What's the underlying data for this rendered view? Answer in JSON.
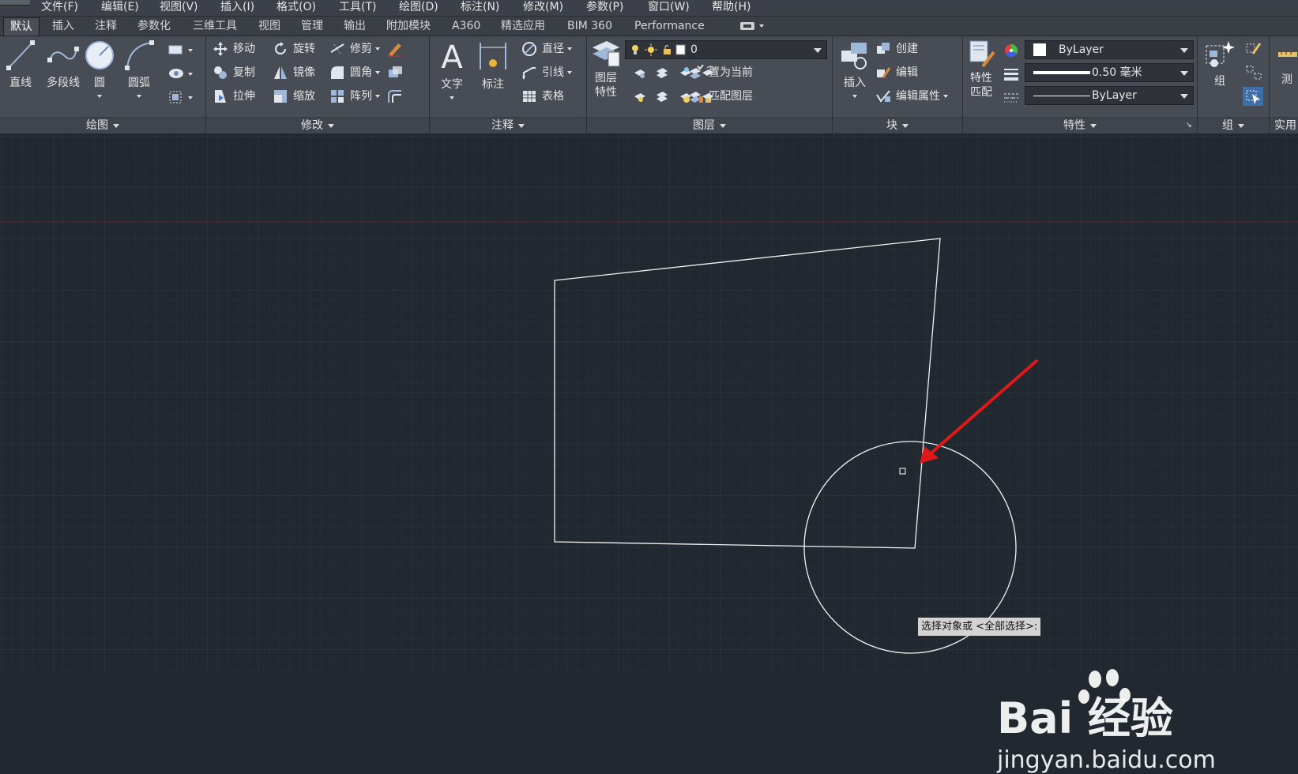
{
  "menubar": {
    "items": [
      "文件(F)",
      "编辑(E)",
      "视图(V)",
      "插入(I)",
      "格式(O)",
      "工具(T)",
      "绘图(D)",
      "标注(N)",
      "修改(M)",
      "参数(P)",
      "窗口(W)",
      "帮助(H)"
    ]
  },
  "tabs": [
    "默认",
    "插入",
    "注释",
    "参数化",
    "三维工具",
    "视图",
    "管理",
    "输出",
    "附加模块",
    "A360",
    "精选应用",
    "BIM 360",
    "Performance"
  ],
  "active_tab": "默认",
  "ribbon": {
    "draw": {
      "title": "绘图",
      "line": "直线",
      "polyline": "多段线",
      "circle": "圆",
      "arc": "圆弧"
    },
    "modify": {
      "title": "修改",
      "move": "移动",
      "rotate": "旋转",
      "trim": "修剪",
      "copy": "复制",
      "mirror": "镜像",
      "fillet": "圆角",
      "stretch": "拉伸",
      "scale": "缩放",
      "array": "阵列"
    },
    "annotation": {
      "title": "注释",
      "text": "文字",
      "dimension": "标注",
      "diameter": "直径",
      "leader": "引线",
      "table": "表格"
    },
    "layers": {
      "title": "图层",
      "properties_line1": "图层",
      "properties_line2": "特性",
      "current_layer": "0",
      "set_current": "置为当前",
      "match_layer": "匹配图层"
    },
    "block": {
      "title": "块",
      "insert": "插入",
      "create": "创建",
      "edit": "编辑",
      "edit_attributes": "编辑属性"
    },
    "properties": {
      "title": "特性",
      "match_line1": "特性",
      "match_line2": "匹配",
      "color": "ByLayer",
      "lineweight": "0.50 毫米",
      "linetype": "ByLayer"
    },
    "groups": {
      "title": "组",
      "group": "组"
    },
    "utilities": {
      "title": "实用",
      "measure": "测"
    }
  },
  "canvas": {
    "tooltip": "选择对象或 <全部选择>:",
    "watermark_logo": "Bai 经验",
    "watermark_url": "jingyan.baidu.com",
    "colors": {
      "background": "#212830",
      "grid": "#2e3540",
      "axis": "#5a2a2a",
      "geometry": "#ffffff",
      "arrow": "#e01818"
    }
  }
}
